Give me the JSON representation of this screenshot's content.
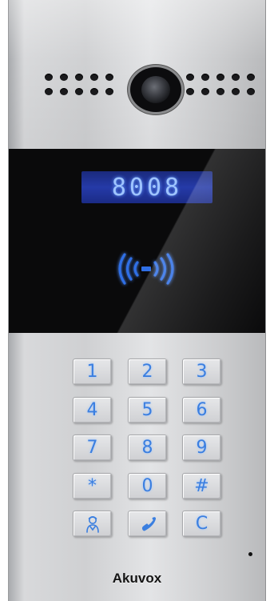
{
  "device": {
    "brand": "Akuvox",
    "display_text": "8008",
    "accent_color": "#3b7fe0",
    "display_color": "#2438a6"
  },
  "keypad": {
    "keys": [
      {
        "label": "1"
      },
      {
        "label": "2"
      },
      {
        "label": "3"
      },
      {
        "label": "4"
      },
      {
        "label": "5"
      },
      {
        "label": "6"
      },
      {
        "label": "7"
      },
      {
        "label": "8"
      },
      {
        "label": "9"
      },
      {
        "label": "*"
      },
      {
        "label": "0"
      },
      {
        "label": "#"
      },
      {
        "label": "",
        "icon": "concierge-icon"
      },
      {
        "label": "",
        "icon": "phone-icon"
      },
      {
        "label": "C"
      }
    ]
  }
}
